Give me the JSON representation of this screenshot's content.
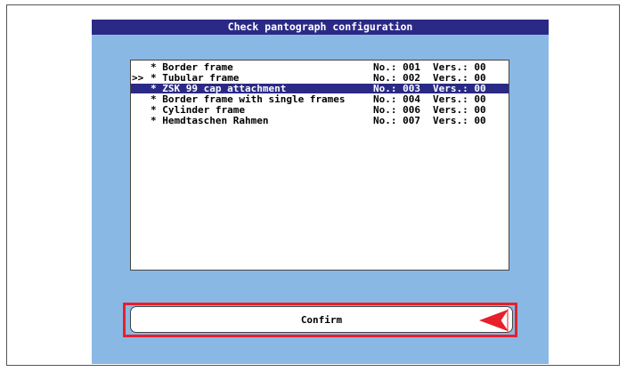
{
  "dialog": {
    "title": "Check pantograph configuration",
    "confirm_label": "Confirm"
  },
  "list": {
    "items": [
      {
        "marker": "",
        "name": "* Border frame",
        "no": "No.: 001",
        "vers": "Vers.: 00",
        "selected": false
      },
      {
        "marker": ">>",
        "name": "* Tubular frame",
        "no": "No.: 002",
        "vers": "Vers.: 00",
        "selected": false
      },
      {
        "marker": "",
        "name": "* ZSK 99 cap attachment",
        "no": "No.: 003",
        "vers": "Vers.: 00",
        "selected": true
      },
      {
        "marker": "",
        "name": "* Border frame with single frames",
        "no": "No.: 004",
        "vers": "Vers.: 00",
        "selected": false
      },
      {
        "marker": "",
        "name": "* Cylinder frame",
        "no": "No.: 006",
        "vers": "Vers.: 00",
        "selected": false
      },
      {
        "marker": "",
        "name": "* Hemdtaschen Rahmen",
        "no": "No.: 007",
        "vers": "Vers.: 00",
        "selected": false
      }
    ]
  },
  "colors": {
    "dialog_background": "#8ab8e4",
    "title_bar": "#2a2a86",
    "selection": "#2a2a86",
    "highlight_frame": "#e8202a"
  },
  "icons": {
    "confirm_arrow": "red-left-arrow-icon"
  }
}
